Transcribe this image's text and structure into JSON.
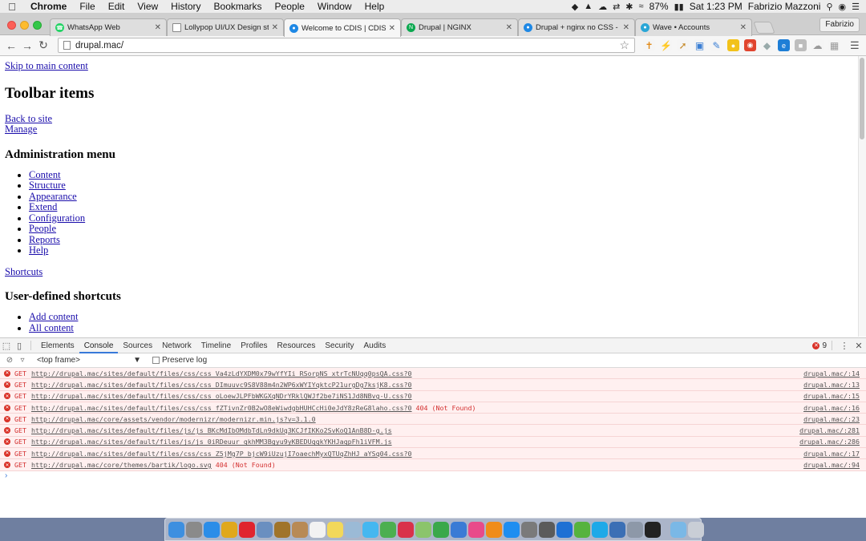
{
  "menubar": {
    "app": "Chrome",
    "items": [
      "File",
      "Edit",
      "View",
      "History",
      "Bookmarks",
      "People",
      "Window",
      "Help"
    ],
    "battery": "87%",
    "clock": "Sat 1:23 PM",
    "user": "Fabrizio Mazzoni"
  },
  "tabs": [
    {
      "label": "WhatsApp Web",
      "color": "#25d366",
      "glyph": "W"
    },
    {
      "label": "Lollypop UI/UX Design stud",
      "color": "#ffffff",
      "glyph": ""
    },
    {
      "label": "Welcome to CDIS | CDIS",
      "color": "#1e88e5",
      "glyph": "D"
    },
    {
      "label": "Drupal | NGINX",
      "color": "#0aa84f",
      "glyph": "N"
    },
    {
      "label": "Drupal + nginx no CSS - Dr",
      "color": "#1e88e5",
      "glyph": "D"
    },
    {
      "label": "Wave • Accounts",
      "color": "#2aa6d6",
      "glyph": "W"
    }
  ],
  "profile_button": "Fabrizio",
  "address_bar": {
    "url": "drupal.mac/"
  },
  "page": {
    "skip_link": "Skip to main content",
    "toolbar_heading": "Toolbar items",
    "back_link": "Back to site",
    "manage_link": "Manage",
    "admin_heading": "Administration menu",
    "admin_items": [
      "Content",
      "Structure",
      "Appearance",
      "Extend",
      "Configuration",
      "People",
      "Reports",
      "Help"
    ],
    "shortcuts_link": "Shortcuts",
    "shortcuts_heading": "User-defined shortcuts",
    "shortcut_items": [
      "Add content",
      "All content"
    ]
  },
  "devtools": {
    "tabs": [
      "Elements",
      "Console",
      "Sources",
      "Network",
      "Timeline",
      "Profiles",
      "Resources",
      "Security",
      "Audits"
    ],
    "active_tab": "Console",
    "error_count": "9",
    "frame_select": "<top frame>",
    "preserve_log": "Preserve log",
    "messages": [
      {
        "method": "GET",
        "url": "http://drupal.mac/sites/default/files/css/css_Va4zLdYXDM0x79wYfYIi_RSorpNS_xtrTcNUqq0psQA.css?0",
        "status": "",
        "source": "drupal.mac/:14"
      },
      {
        "method": "GET",
        "url": "http://drupal.mac/sites/default/files/css/css_DImuuvc9S8V88m4n2WP6xWYIYqktcP21urgDg7ksjK8.css?0",
        "status": "",
        "source": "drupal.mac/:13"
      },
      {
        "method": "GET",
        "url": "http://drupal.mac/sites/default/files/css/css_oLoewJLPFbWKGXqNDrYRklQWJf2be7iNS1Jd8NBvg-U.css?0",
        "status": "",
        "source": "drupal.mac/:15"
      },
      {
        "method": "GET",
        "url": "http://drupal.mac/sites/default/files/css/css_fZTivnZr0B2wO8eWiwdgbHUHCcHi0eJdY8zReG8laho.css?0",
        "status": "404 (Not Found)",
        "source": "drupal.mac/:16"
      },
      {
        "method": "GET",
        "url": "http://drupal.mac/core/assets/vendor/modernizr/modernizr.min.js?v=3.1.0",
        "status": "",
        "source": "drupal.mac/:23"
      },
      {
        "method": "GET",
        "url": "http://drupal.mac/sites/default/files/js/js_BKcMdIbOMdbTdLn9dkUq3KCJfIKKo2SvKoQ1AnB8D-g.js",
        "status": "",
        "source": "drupal.mac/:281"
      },
      {
        "method": "GET",
        "url": "http://drupal.mac/sites/default/files/js/js_0iRDeuur_qkhMM3Bgyu9yKBEDUqqkYKHJaqpFh1iVFM.js",
        "status": "",
        "source": "drupal.mac/:286"
      },
      {
        "method": "GET",
        "url": "http://drupal.mac/sites/default/files/css/css_Z5jMg7P_bjcW9iUzujI7oaechMyxQTUqZhHJ_aYSq04.css?0",
        "status": "",
        "source": "drupal.mac/:17"
      },
      {
        "method": "GET",
        "url": "http://drupal.mac/core/themes/bartik/logo.svg",
        "status": "404 (Not Found)",
        "source": "drupal.mac/:94"
      }
    ]
  },
  "dock": {
    "icons": [
      {
        "name": "finder-icon",
        "color": "#3d8fe0"
      },
      {
        "name": "launchpad-icon",
        "color": "#8a8a8a"
      },
      {
        "name": "safari-icon",
        "color": "#2b8de8"
      },
      {
        "name": "chrome-icon",
        "color": "#e0a81c"
      },
      {
        "name": "opera-icon",
        "color": "#e0242e"
      },
      {
        "name": "preview-icon",
        "color": "#6a8fc0"
      },
      {
        "name": "notes-icon",
        "color": "#a0742a"
      },
      {
        "name": "contacts-icon",
        "color": "#b88a55"
      },
      {
        "name": "calendar-icon",
        "color": "#f2f2f2"
      },
      {
        "name": "stickies-icon",
        "color": "#f2d85a"
      },
      {
        "name": "photos-icon",
        "color": "#9bbad6"
      },
      {
        "name": "messages-icon",
        "color": "#45b7f0"
      },
      {
        "name": "facetime-icon",
        "color": "#4caf50"
      },
      {
        "name": "photo-booth-icon",
        "color": "#d9314a"
      },
      {
        "name": "maps-icon",
        "color": "#8bc46b"
      },
      {
        "name": "numbers-icon",
        "color": "#3aa84a"
      },
      {
        "name": "keynote-icon",
        "color": "#3a7bd5"
      },
      {
        "name": "itunes-icon",
        "color": "#e84a8a"
      },
      {
        "name": "ibooks-icon",
        "color": "#f08c1a"
      },
      {
        "name": "app-store-icon",
        "color": "#1e8ef0"
      },
      {
        "name": "system-preferences-icon",
        "color": "#7a7a7a"
      },
      {
        "name": "activity-monitor-icon",
        "color": "#5b5b5b"
      },
      {
        "name": "teamviewer-icon",
        "color": "#1e70d4"
      },
      {
        "name": "utorrent-icon",
        "color": "#56b33e"
      },
      {
        "name": "skype-icon",
        "color": "#1ea9e8"
      },
      {
        "name": "network-icon",
        "color": "#3b6fb5"
      },
      {
        "name": "utility-icon",
        "color": "#8d98a8"
      },
      {
        "name": "terminal-icon",
        "color": "#222222"
      },
      {
        "name": "downloads-folder-icon",
        "color": "#7ab8e6"
      },
      {
        "name": "trash-icon",
        "color": "#c9ced6"
      }
    ]
  }
}
